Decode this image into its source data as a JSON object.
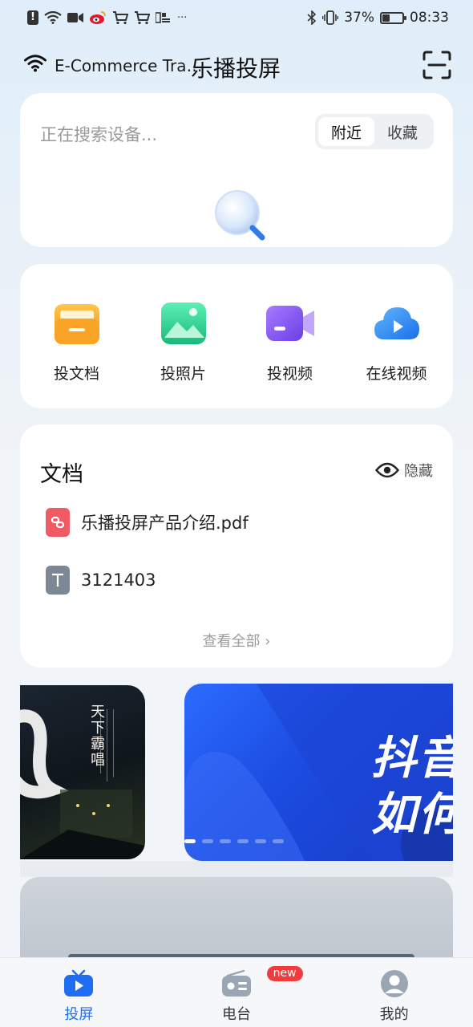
{
  "status_bar": {
    "time": "08:33",
    "battery": "37%",
    "battery_level": 0.37,
    "left_icons": [
      "notification-alert-icon",
      "wifi-icon",
      "video-icon",
      "weibo-icon",
      "cart-icon",
      "cart-icon",
      "app-icon",
      "more-icon"
    ],
    "right_icons": [
      "bluetooth-icon",
      "vibrate-icon",
      "battery-icon"
    ],
    "more": "···"
  },
  "header": {
    "network_name": "E-Commerce Tra…",
    "app_title": "乐播投屏",
    "scan_icon": "scan-icon"
  },
  "search": {
    "status_text": "正在搜索设备...",
    "tabs": [
      {
        "label": "附近",
        "active": true
      },
      {
        "label": "收藏",
        "active": false
      }
    ]
  },
  "actions": [
    {
      "label": "投文档",
      "icon": "folder-icon",
      "color": "#f7a51c"
    },
    {
      "label": "投照片",
      "icon": "image-icon",
      "color": "#2fcf8f"
    },
    {
      "label": "投视频",
      "icon": "video-camera-icon",
      "color": "#8b5cf6"
    },
    {
      "label": "在线视频",
      "icon": "cloud-play-icon",
      "color": "#2b8cf0"
    }
  ],
  "documents": {
    "title": "文档",
    "hide_label": "隐藏",
    "items": [
      {
        "name": "乐播投屏产品介绍.pdf",
        "icon": "pdf-icon",
        "color": "#ef5a64"
      },
      {
        "name": "3121403",
        "icon": "text-file-icon",
        "color": "#7d8896"
      }
    ],
    "view_all": "查看全部 ›"
  },
  "banners": {
    "left_caption": "天下霸唱",
    "right_text_line1": "抖音",
    "right_text_line2": "如何",
    "dot_count": 6,
    "active_dot": 0
  },
  "tab_bar": {
    "tabs": [
      {
        "label": "投屏",
        "icon": "tv-icon",
        "active": true
      },
      {
        "label": "电台",
        "icon": "radio-icon",
        "active": false,
        "badge": "new"
      },
      {
        "label": "我的",
        "icon": "profile-icon",
        "active": false
      }
    ]
  },
  "colors": {
    "accent": "#1d6ef2",
    "badge": "#f03c3c"
  }
}
